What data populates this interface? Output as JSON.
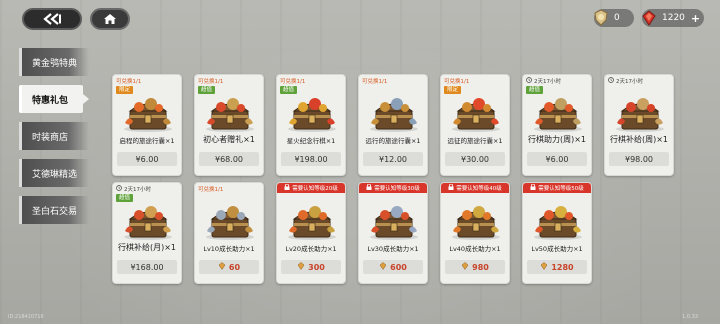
{
  "header": {
    "back_icon": "double-chevron-left-icon",
    "home_icon": "home-icon",
    "currencies": [
      {
        "icon": "medal-icon",
        "value": "0"
      },
      {
        "icon": "red-gem-icon",
        "value": "1220",
        "add": "+"
      }
    ]
  },
  "sidebar": {
    "items": [
      {
        "label": "黄金鸮特典",
        "active": false
      },
      {
        "label": "特惠礼包",
        "active": true
      },
      {
        "label": "时装商店",
        "active": false
      },
      {
        "label": "艾德琳精选",
        "active": false
      },
      {
        "label": "圣白石交易",
        "active": false
      }
    ]
  },
  "cards": [
    {
      "tag": "可兑换1/1",
      "tag_style": "orange",
      "badge": "限定",
      "badge_type": "limit",
      "name": "启程的旅途行囊×1",
      "price": "¥6.00",
      "price_type": "cny",
      "colors": [
        "#e46a2a",
        "#c08a3a"
      ]
    },
    {
      "tag": "可兑换1/1",
      "tag_style": "orange",
      "badge": "超值",
      "badge_type": "super",
      "name": "初心者赠礼×1",
      "price": "¥68.00",
      "price_type": "cny",
      "big": true,
      "colors": [
        "#d94a2a",
        "#caa050"
      ]
    },
    {
      "tag": "可兑换1/1",
      "tag_style": "orange",
      "badge": "超值",
      "badge_type": "super",
      "name": "星火纪念行棋×1",
      "price": "¥198.00",
      "price_type": "cny",
      "colors": [
        "#e0a530",
        "#d8402a"
      ]
    },
    {
      "tag": "可兑换1/1",
      "tag_style": "orange",
      "badge": "",
      "badge_type": "",
      "name": "远行的旅途行囊×1",
      "price": "¥12.00",
      "price_type": "cny",
      "colors": [
        "#c9903a",
        "#8aa0b8"
      ]
    },
    {
      "tag": "可兑换1/1",
      "tag_style": "orange",
      "badge": "限定",
      "badge_type": "limit",
      "name": "远征的旅途行囊×1",
      "price": "¥30.00",
      "price_type": "cny",
      "colors": [
        "#d28a30",
        "#e04a2a"
      ]
    },
    {
      "tag": "2天17小时",
      "tag_style": "plain",
      "badge": "超值",
      "badge_type": "super",
      "name": "行棋助力(周)×1",
      "price": "¥6.00",
      "price_type": "cny",
      "big": true,
      "colors": [
        "#e05a2a",
        "#bfa060"
      ]
    },
    {
      "tag": "2天17小时",
      "tag_style": "plain",
      "badge": "",
      "badge_type": "",
      "name": "行棋补给(周)×1",
      "price": "¥98.00",
      "price_type": "cny",
      "big": true,
      "colors": [
        "#d6452a",
        "#caa060"
      ]
    },
    {
      "tag": "2天17小时",
      "tag_style": "plain",
      "badge": "超值",
      "badge_type": "super",
      "name": "行棋补给(月)×1",
      "price": "¥168.00",
      "price_type": "cny",
      "big": true,
      "colors": [
        "#d8502a",
        "#d0a050"
      ]
    },
    {
      "tag": "可兑换1/1",
      "tag_style": "orange",
      "badge": "",
      "badge_type": "",
      "name": "Lv10成长助力×1",
      "price": "60",
      "price_type": "gem",
      "colors": [
        "#9aa8b8",
        "#c09040"
      ]
    },
    {
      "tag": "需要认知等级20级",
      "tag_style": "redbar",
      "badge": "",
      "badge_type": "",
      "name": "Lv20成长助力×1",
      "price": "300",
      "price_type": "gem",
      "colors": [
        "#e06a2a",
        "#c9a040"
      ]
    },
    {
      "tag": "需要认知等级30级",
      "tag_style": "redbar",
      "badge": "",
      "badge_type": "",
      "name": "Lv30成长助力×1",
      "price": "600",
      "price_type": "gem",
      "colors": [
        "#d8502a",
        "#98a8c0"
      ]
    },
    {
      "tag": "需要认知等级40级",
      "tag_style": "redbar",
      "badge": "",
      "badge_type": "",
      "name": "Lv40成长助力×1",
      "price": "980",
      "price_type": "gem",
      "colors": [
        "#e07a2a",
        "#d0a840"
      ]
    },
    {
      "tag": "需要认知等级50级",
      "tag_style": "redbar",
      "badge": "",
      "badge_type": "",
      "name": "Lv50成长助力×1",
      "price": "1280",
      "price_type": "gem",
      "colors": [
        "#e0582a",
        "#d8b040"
      ]
    }
  ],
  "footer": {
    "uid": "ID:218410716",
    "version": "1.0.33"
  }
}
